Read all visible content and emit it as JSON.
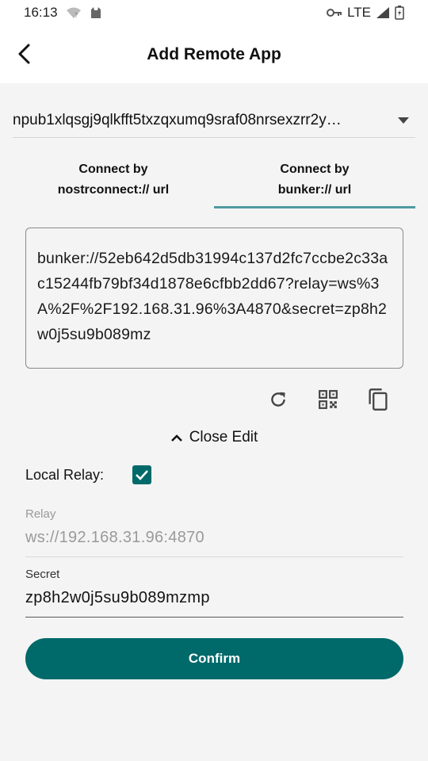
{
  "status_bar": {
    "time": "16:13",
    "network": "LTE",
    "icons": [
      "wifi-icon",
      "cat-icon",
      "key-icon",
      "signal-icon",
      "battery-icon"
    ]
  },
  "app_bar": {
    "title": "Add Remote App",
    "back_icon": "back-arrow-icon"
  },
  "account_select": {
    "value": "npub1xlqsgj9qlkfft5txzqxumq9sraf08nrsexzrr2y…"
  },
  "tabs": [
    {
      "label": "Connect by\nnostrconnect:// url",
      "active": false
    },
    {
      "label": "Connect by\nbunker:// url",
      "active": true
    }
  ],
  "bunker_url": "bunker://52eb642d5db31994c137d2fc7ccbe2c33ac15244fb79bf34d1878e6cfbb2dd67?relay=ws%3A%2F%2F192.168.31.96%3A4870&secret=zp8h2w0j5su9b089mz",
  "actions": [
    "refresh-icon",
    "qr-code-icon",
    "copy-icon"
  ],
  "close_edit": {
    "label": "Close Edit"
  },
  "local_relay": {
    "label": "Local Relay:",
    "checked": true
  },
  "relay_field": {
    "label": "Relay",
    "value": "ws://192.168.31.96:4870"
  },
  "secret_field": {
    "label": "Secret",
    "value": "zp8h2w0j5su9b089mzmp"
  },
  "confirm": {
    "label": "Confirm"
  },
  "colors": {
    "primary": "#00696a",
    "tab_indicator": "#4f9aa0",
    "background": "#f4f4f4"
  }
}
